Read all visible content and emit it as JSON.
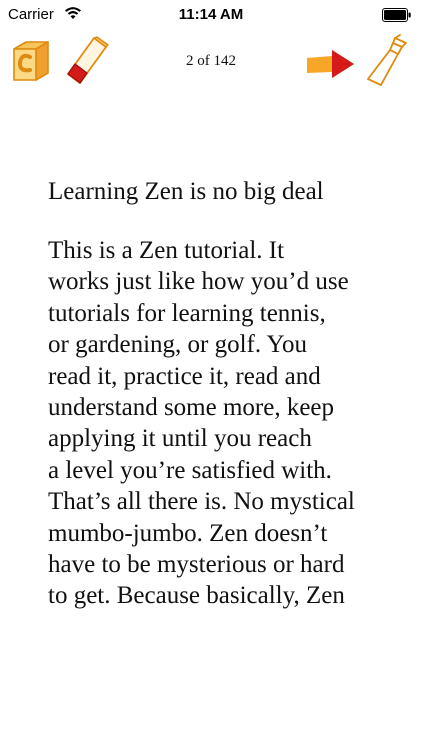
{
  "status_bar": {
    "carrier": "Carrier",
    "time": "11:14 AM",
    "icons": [
      "wifi-icon",
      "battery-icon"
    ]
  },
  "toolbar": {
    "page_counter": "2 of 142",
    "left_icons": [
      "book-cover-icon",
      "eraser-icon"
    ],
    "right_icons": [
      "next-arrow-icon",
      "spray-bottle-icon"
    ],
    "accent_colors": {
      "orange": "#f0a030",
      "red": "#d51a1a"
    }
  },
  "content": {
    "title": "Learning Zen is no big deal",
    "lines": [
      "This is a Zen tutorial. It",
      "works just like how you’d use",
      "tutorials for learning tennis,",
      "or gardening, or golf. You",
      "read it, practice it, read and",
      "understand some more, keep",
      "applying it until you reach",
      "a level you’re satisfied with.",
      "That’s all there is. No mystical",
      "mumbo-jumbo. Zen doesn’t",
      "have to be mysterious or hard",
      "to get. Because basically, Zen"
    ]
  }
}
